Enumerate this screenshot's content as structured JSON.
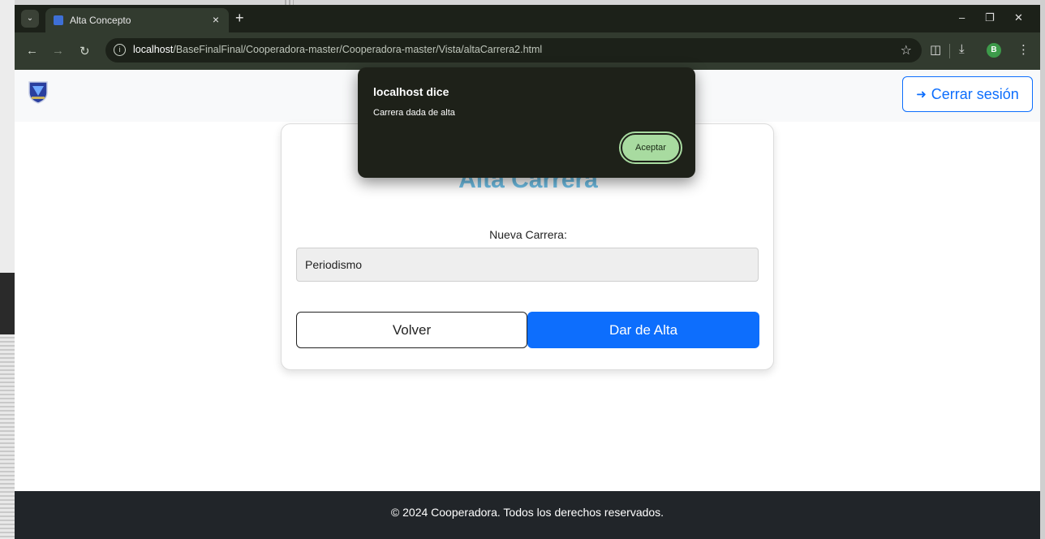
{
  "browser": {
    "tab_title": "Alta Concepto",
    "tab_close": "×",
    "new_tab": "+",
    "url_host": "localhost",
    "url_path": "/BaseFinalFinal/Cooperadora-master/Cooperadora-master/Vista/altaCarrera2.html",
    "profile_initial": "B",
    "window_controls": [
      "–",
      "❐",
      "✕"
    ],
    "icons": [
      "chevron-down-icon",
      "back-icon",
      "forward-icon",
      "reload-icon",
      "info-icon",
      "star-icon",
      "extensions-icon",
      "download-icon",
      "menu-icon"
    ]
  },
  "navbar": {
    "logout_label": "Cerrar sesión",
    "logout_icon": "sign-out-icon"
  },
  "card": {
    "title": "Alta Carrera",
    "field_label": "Nueva Carrera:",
    "field_value": "Periodismo",
    "back_label": "Volver",
    "submit_label": "Dar de Alta"
  },
  "footer": {
    "text": "© 2024 Cooperadora. Todos los derechos reservados."
  },
  "dialog": {
    "title": "localhost dice",
    "message": "Carrera dada de alta",
    "ok_label": "Aceptar"
  },
  "colors": {
    "primary": "#0d6efd",
    "title": "#6fc1e8",
    "footer_bg": "#212529",
    "dialog_button": "#a8dba0"
  }
}
